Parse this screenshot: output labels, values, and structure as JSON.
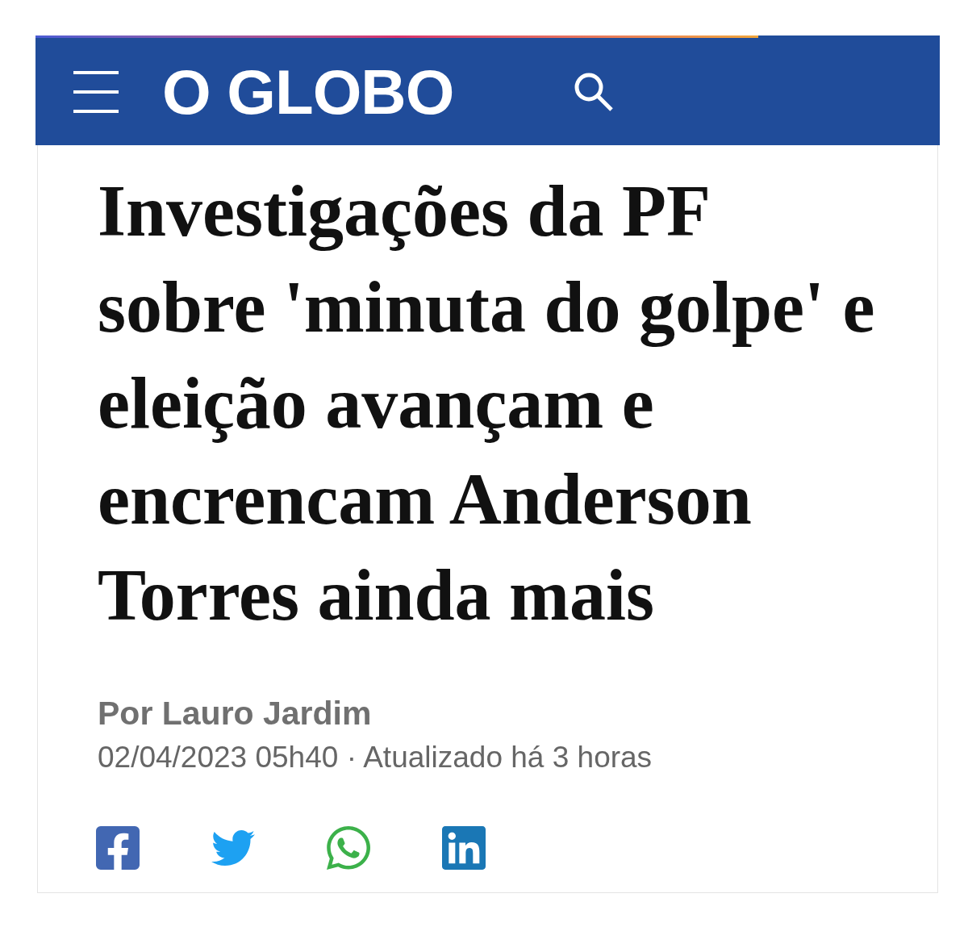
{
  "header": {
    "logo": "O GLOBO"
  },
  "article": {
    "headline": "Investigações da PF sobre 'minuta do golpe' e eleição avançam e encrencam Anderson Torres ainda mais",
    "byline": "Por Lauro Jardim",
    "date": "02/04/2023 05h40 · Atualizado há 3 horas"
  },
  "share_buttons": [
    {
      "kind": "facebook"
    },
    {
      "kind": "twitter"
    },
    {
      "kind": "whatsapp"
    },
    {
      "kind": "linkedin"
    }
  ]
}
